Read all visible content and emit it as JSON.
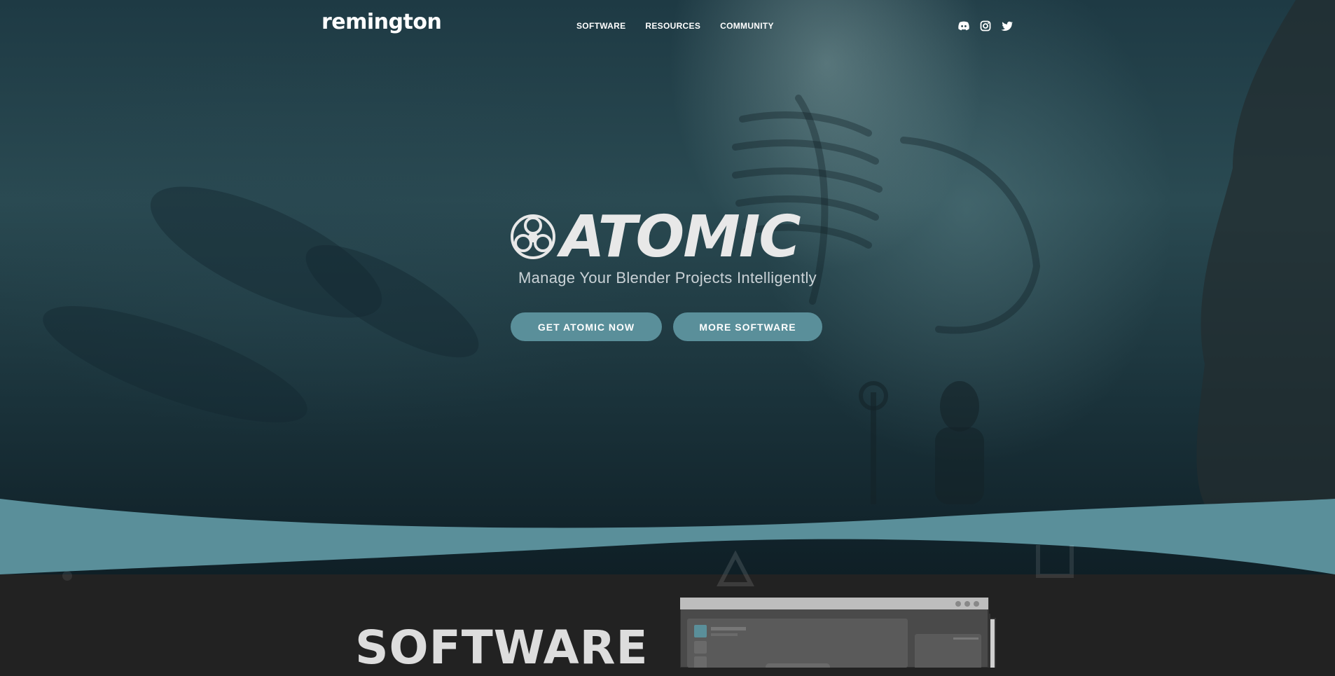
{
  "nav": {
    "logo": "remington",
    "menu": [
      {
        "label": "SOFTWARE"
      },
      {
        "label": "RESOURCES"
      },
      {
        "label": "COMMUNITY"
      }
    ],
    "social": [
      "discord-icon",
      "instagram-icon",
      "twitter-icon"
    ]
  },
  "hero": {
    "product_name": "ATOMIC",
    "tagline": "Manage Your Blender Projects Intelligently",
    "primary_button": "GET ATOMIC NOW",
    "secondary_button": "MORE SOFTWARE"
  },
  "software_section": {
    "title": "SOFTWARE"
  },
  "colors": {
    "accent": "#5a8f9a",
    "dark_background": "#222222",
    "text_light": "#e8e8e8"
  }
}
